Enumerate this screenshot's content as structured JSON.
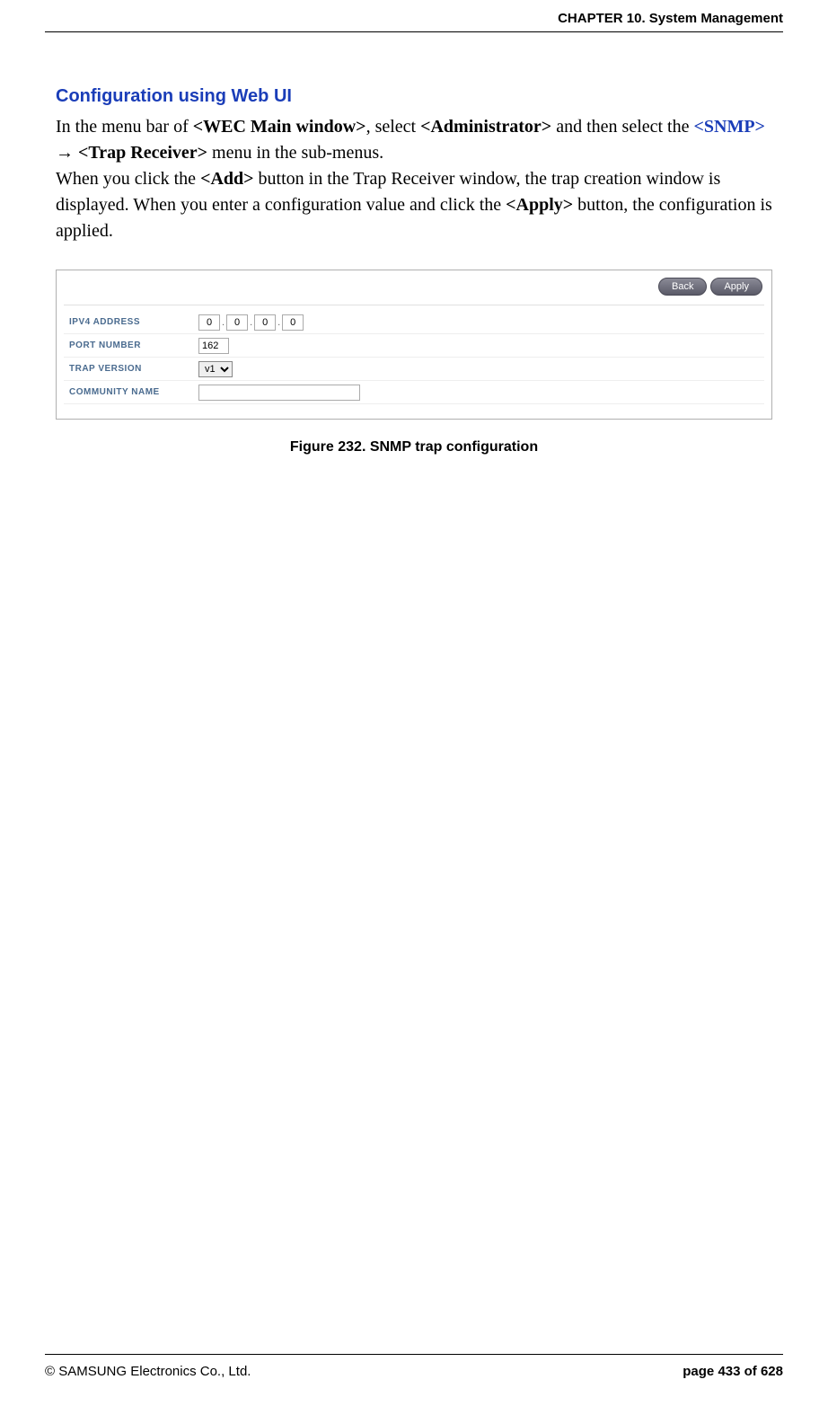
{
  "header": {
    "chapter": "CHAPTER 10. System Management"
  },
  "section": {
    "title": "Configuration using Web UI",
    "p1_a": "In the menu bar of ",
    "p1_b": "<WEC Main window>",
    "p1_c": ", select ",
    "p1_d": "<Administrator>",
    "p1_e": " and then select the ",
    "p1_f": "<SNMP>",
    "p1_g": " → ",
    "p1_h": "<Trap Receiver>",
    "p1_i": " menu in the sub-menus.",
    "p2_a": "When you click the ",
    "p2_b": "<Add>",
    "p2_c": " button in the Trap Receiver window, the trap creation window is displayed. When you enter a configuration value and click the ",
    "p2_d": "<Apply>",
    "p2_e": " button, the configuration is applied."
  },
  "figure": {
    "buttons": {
      "back": "Back",
      "apply": "Apply"
    },
    "rows": {
      "ipv4": {
        "label": "IPV4 ADDRESS",
        "o1": "0",
        "o2": "0",
        "o3": "0",
        "o4": "0"
      },
      "port": {
        "label": "PORT NUMBER",
        "value": "162"
      },
      "version": {
        "label": "TRAP VERSION",
        "value": "v1"
      },
      "community": {
        "label": "COMMUNITY NAME",
        "value": ""
      }
    },
    "caption": "Figure 232. SNMP trap configuration"
  },
  "footer": {
    "copyright": "© SAMSUNG Electronics Co., Ltd.",
    "page": "page 433 of 628"
  }
}
